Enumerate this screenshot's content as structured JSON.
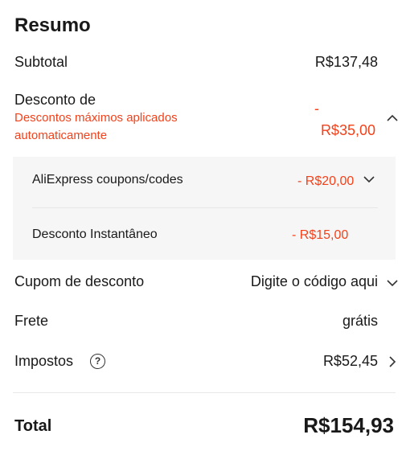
{
  "summary": {
    "title": "Resumo",
    "subtotal": {
      "label": "Subtotal",
      "value": "R$137,48"
    },
    "discount": {
      "label": "Desconto de",
      "note_line1": "Descontos máximos aplicados",
      "note_line2": "automaticamente",
      "value_dash": "-",
      "value": "R$35,00",
      "items": [
        {
          "label": "AliExpress coupons/codes",
          "value": "- R$20,00"
        },
        {
          "label": "Desconto Instantâneo",
          "value": "- R$15,00"
        }
      ]
    },
    "coupon": {
      "label": "Cupom de desconto",
      "value": "Digite o código aqui"
    },
    "shipping": {
      "label": "Frete",
      "value": "grátis"
    },
    "taxes": {
      "label": "Impostos",
      "help": "?",
      "value": "R$52,45"
    },
    "total": {
      "label": "Total",
      "value": "R$154,93"
    }
  },
  "colors": {
    "accent": "#f3411a",
    "text": "#191919",
    "panel": "#f6f6f6"
  },
  "icons": [
    "chevron-up-icon",
    "chevron-down-icon",
    "help-circle-icon",
    "chevron-right-icon"
  ]
}
